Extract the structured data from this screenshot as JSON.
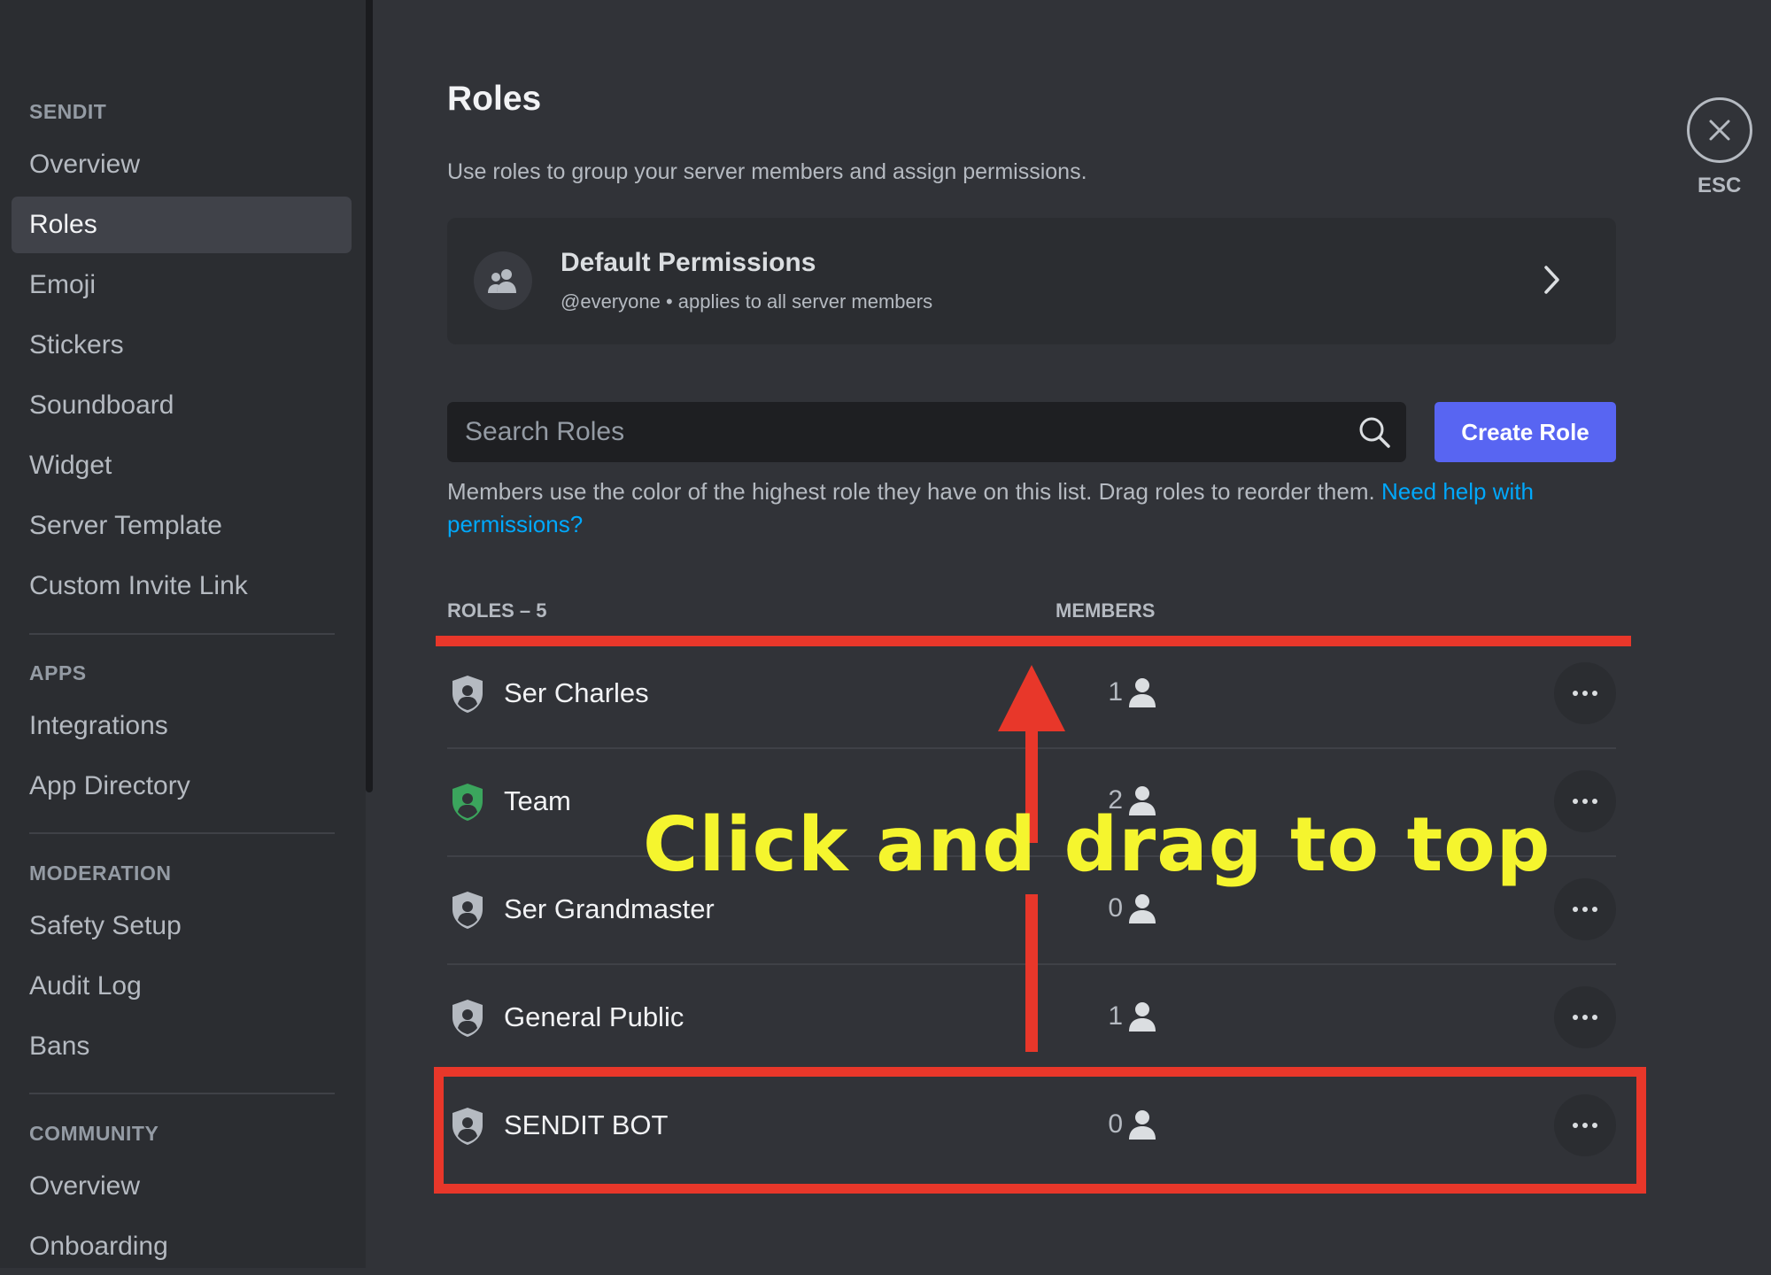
{
  "sidebar": {
    "sections": [
      {
        "header": "SENDIT",
        "items": [
          "Overview",
          "Roles",
          "Emoji",
          "Stickers",
          "Soundboard",
          "Widget",
          "Server Template",
          "Custom Invite Link"
        ]
      },
      {
        "header": "APPS",
        "items": [
          "Integrations",
          "App Directory"
        ]
      },
      {
        "header": "MODERATION",
        "items": [
          "Safety Setup",
          "Audit Log",
          "Bans"
        ]
      },
      {
        "header": "COMMUNITY",
        "items": [
          "Overview",
          "Onboarding"
        ]
      }
    ],
    "active_item": "Roles"
  },
  "header": {
    "title": "Roles",
    "subtitle": "Use roles to group your server members and assign permissions."
  },
  "default_permissions": {
    "title": "Default Permissions",
    "subtitle": "@everyone • applies to all server members"
  },
  "search": {
    "placeholder": "Search Roles"
  },
  "create_role_label": "Create Role",
  "help": {
    "text": "Members use the color of the highest role they have on this list. Drag roles to reorder them. ",
    "link": "Need help with permissions?"
  },
  "table": {
    "roles_header": "ROLES – 5",
    "members_header": "MEMBERS",
    "rows": [
      {
        "name": "Ser Charles",
        "members": "1",
        "color": "#b5bac1"
      },
      {
        "name": "Team",
        "members": "2",
        "color": "#3ba55d"
      },
      {
        "name": "Ser Grandmaster",
        "members": "0",
        "color": "#b5bac1"
      },
      {
        "name": "General Public",
        "members": "1",
        "color": "#b5bac1"
      },
      {
        "name": "SENDIT BOT",
        "members": "0",
        "color": "#b5bac1"
      }
    ]
  },
  "close": {
    "label": "ESC"
  },
  "annotation": {
    "text": "Click and drag to top",
    "color": "#f5f52e",
    "arrow_color": "#e8372a"
  },
  "colors": {
    "accent": "#5865f2",
    "link": "#00a8fc",
    "annotation_red": "#e8372a"
  }
}
